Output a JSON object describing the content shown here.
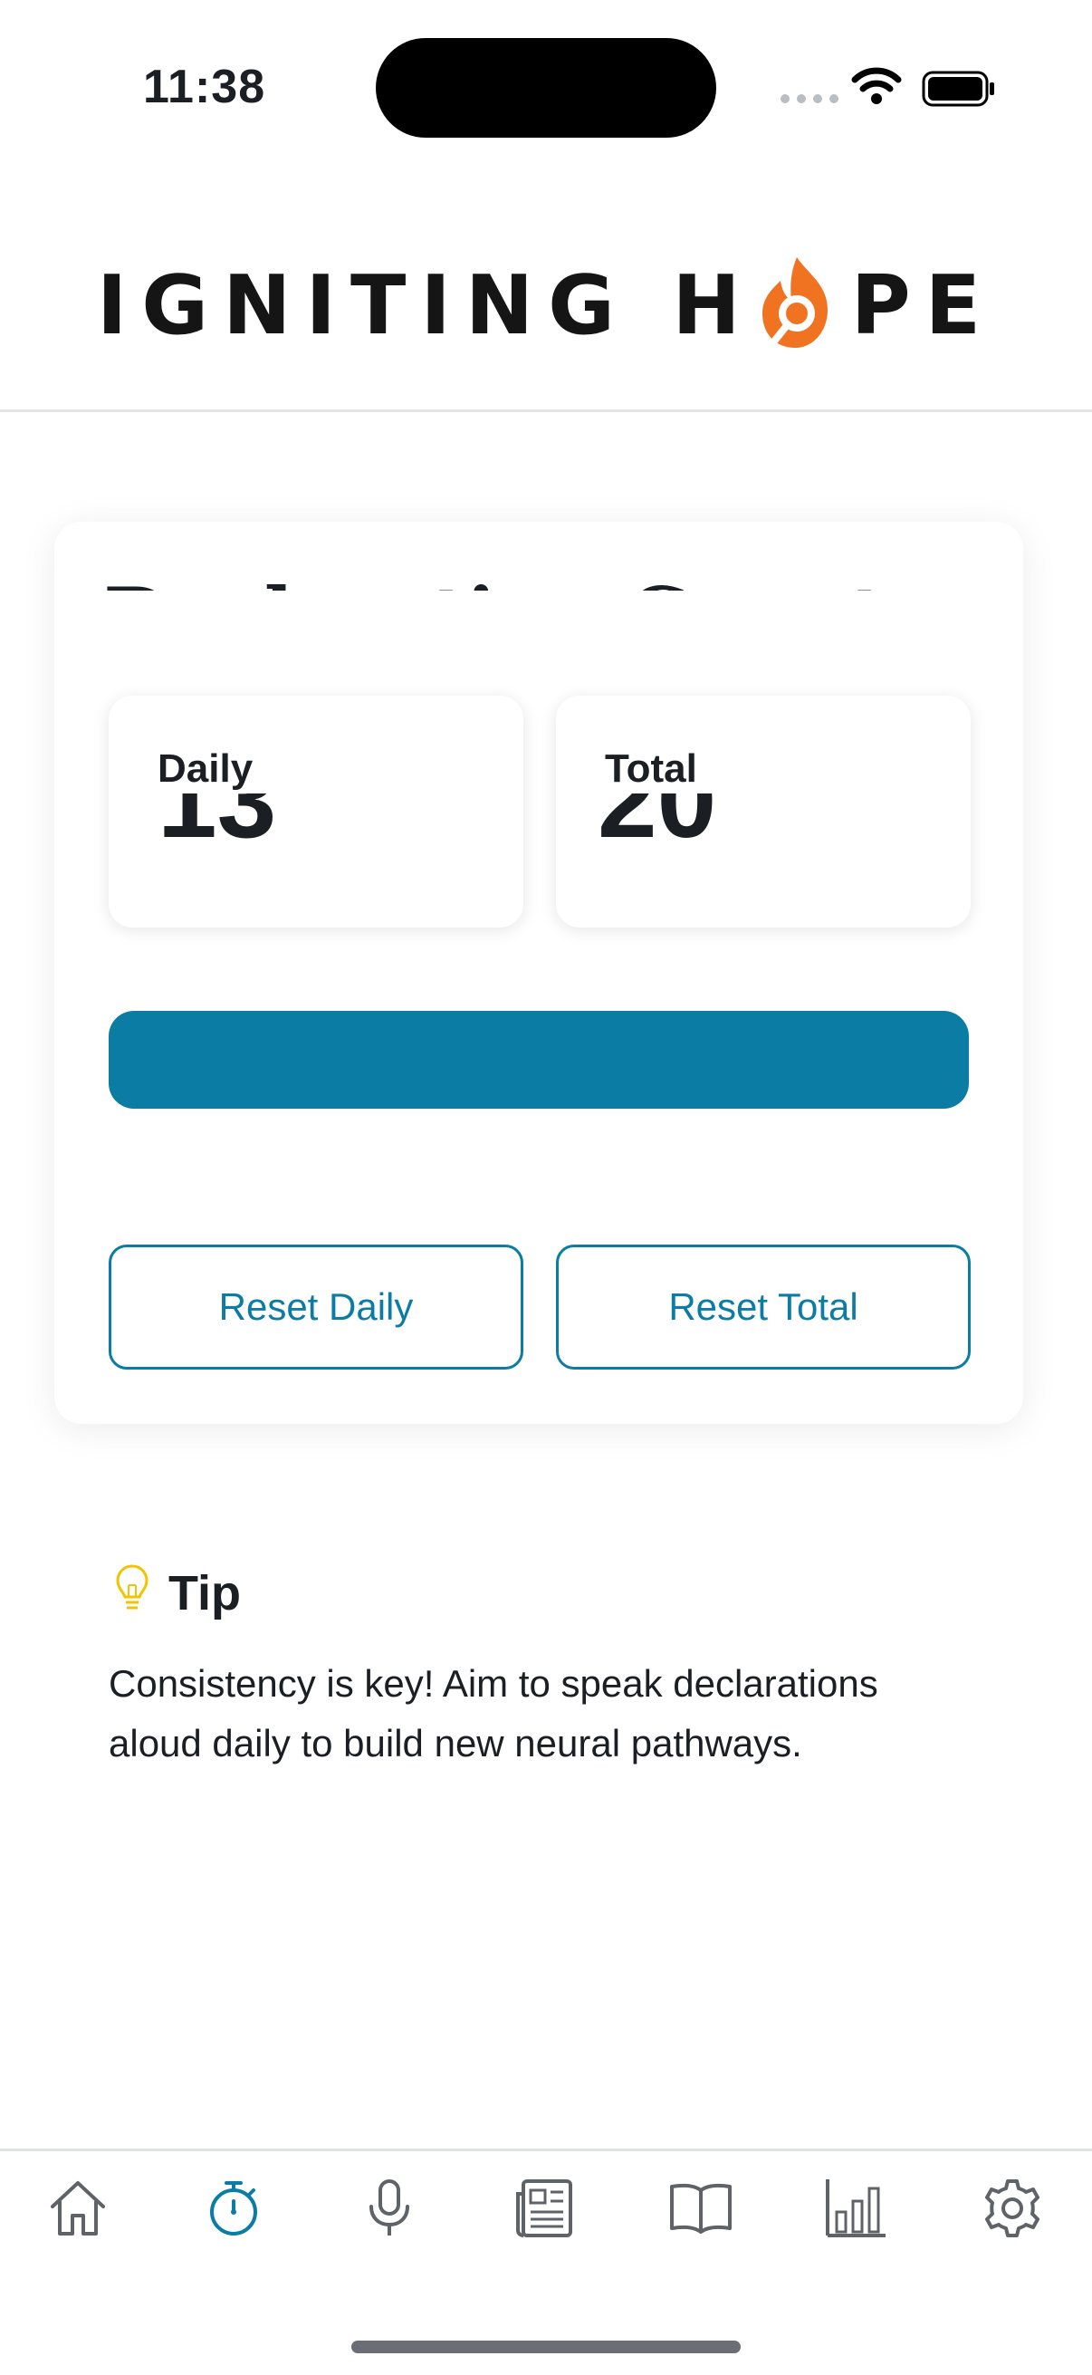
{
  "status_bar": {
    "time": "11:38"
  },
  "header": {
    "logo_text_left": "IGNITING H",
    "logo_text_right": "PE",
    "logo_icon": "flame-o-icon"
  },
  "card": {
    "title": "Declaration Counter",
    "daily": {
      "label": "Daily",
      "value": "13"
    },
    "total": {
      "label": "Total",
      "value": "20"
    },
    "reset_daily_label": "Reset Daily",
    "reset_total_label": "Reset Total"
  },
  "tip": {
    "icon": "lightbulb-icon",
    "title": "Tip",
    "text": "Consistency is key! Aim to speak declarations aloud daily to build new neural pathways."
  },
  "tab_bar": {
    "items": [
      {
        "icon": "home-icon",
        "active": false
      },
      {
        "icon": "stopwatch-icon",
        "active": true
      },
      {
        "icon": "microphone-icon",
        "active": false
      },
      {
        "icon": "newspaper-icon",
        "active": false
      },
      {
        "icon": "book-icon",
        "active": false
      },
      {
        "icon": "bar-chart-icon",
        "active": false
      },
      {
        "icon": "gear-icon",
        "active": false
      }
    ]
  },
  "colors": {
    "accent": "#0b7ca3",
    "logo_flame": "#f07322",
    "tip_icon": "#f2c300",
    "inactive_icon": "#5f6368"
  }
}
